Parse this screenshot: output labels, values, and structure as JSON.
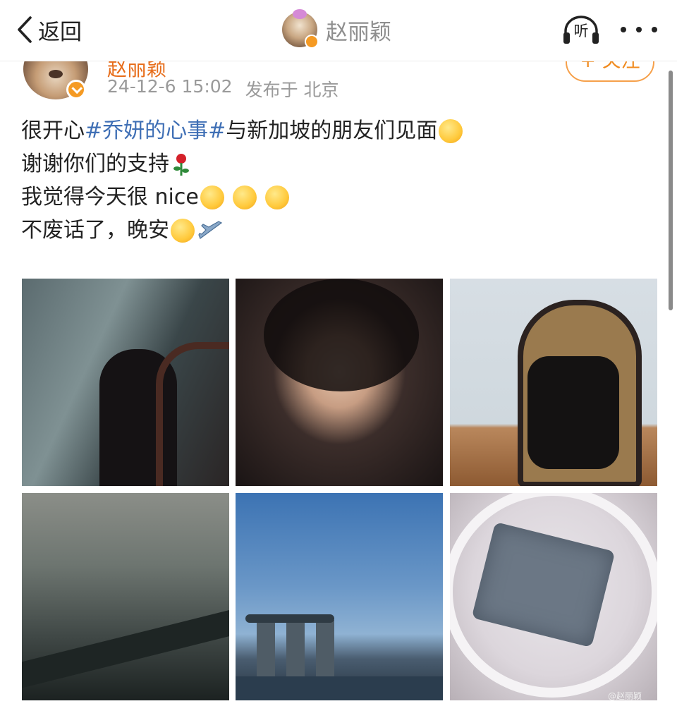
{
  "nav": {
    "back_label": "返回",
    "title_name": "赵丽颖",
    "listen_label": "听"
  },
  "post": {
    "author_name": "赵丽颖",
    "timestamp": "24-12-6 15:02",
    "location": "发布于 北京",
    "follow_label": "+ 关注",
    "lines": {
      "l1_pre": "很开心",
      "l1_hashtag": "#乔妍的心事#",
      "l1_post": " 与新加坡的朋友们见面",
      "l2": "谢谢你们的支持",
      "l3": "我觉得今天很 nice",
      "l4": "不废话了，晚安"
    },
    "watermark": "@赵丽颖"
  },
  "icons": {
    "back": "chevron-left-icon",
    "listen": "headphones-icon",
    "more": "more-dots-icon",
    "verified": "verified-badge-icon"
  },
  "colors": {
    "hashtag": "#3f6fb5",
    "follow": "#f08a1d",
    "meta": "#9a9a9a"
  }
}
